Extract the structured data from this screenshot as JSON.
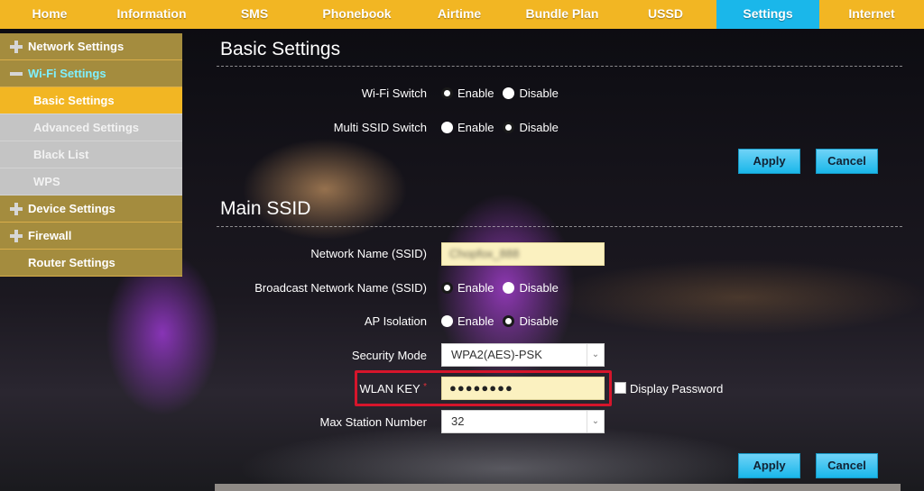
{
  "topnav": {
    "tabs": [
      {
        "label": "Home"
      },
      {
        "label": "Information"
      },
      {
        "label": "SMS"
      },
      {
        "label": "Phonebook"
      },
      {
        "label": "Airtime"
      },
      {
        "label": "Bundle Plan"
      },
      {
        "label": "USSD"
      },
      {
        "label": "Settings",
        "active": true
      },
      {
        "label": "Internet"
      }
    ]
  },
  "sidebar": {
    "items": [
      {
        "label": "Network Settings",
        "type": "group",
        "icon": "plus-icon"
      },
      {
        "label": "Wi-Fi Settings",
        "type": "group",
        "icon": "minus-icon",
        "expanded": true
      },
      {
        "label": "Basic Settings",
        "type": "sub",
        "active": true
      },
      {
        "label": "Advanced Settings",
        "type": "sub"
      },
      {
        "label": "Black List",
        "type": "sub"
      },
      {
        "label": "WPS",
        "type": "sub"
      },
      {
        "label": "Device Settings",
        "type": "group",
        "icon": "plus-icon"
      },
      {
        "label": "Firewall",
        "type": "group",
        "icon": "plus-icon"
      },
      {
        "label": "Router Settings",
        "type": "group"
      }
    ]
  },
  "basic": {
    "title": "Basic Settings",
    "wifi_switch": {
      "label": "Wi-Fi Switch",
      "options": [
        "Enable",
        "Disable"
      ],
      "selected": "Enable"
    },
    "multi_ssid": {
      "label": "Multi SSID Switch",
      "options": [
        "Enable",
        "Disable"
      ],
      "selected": "Disable"
    },
    "apply": "Apply",
    "cancel": "Cancel"
  },
  "main_ssid": {
    "title": "Main SSID",
    "network_name": {
      "label": "Network Name (SSID)",
      "value": "Chopfox_888"
    },
    "broadcast": {
      "label": "Broadcast Network Name (SSID)",
      "options": [
        "Enable",
        "Disable"
      ],
      "selected": "Enable"
    },
    "ap_isolation": {
      "label": "AP Isolation",
      "options": [
        "Enable",
        "Disable"
      ],
      "selected": "Disable"
    },
    "security_mode": {
      "label": "Security Mode",
      "value": "WPA2(AES)-PSK"
    },
    "wlan_key": {
      "label": "WLAN KEY",
      "required_mark": "*",
      "value": "●●●●●●●●"
    },
    "display_password": "Display Password",
    "max_station": {
      "label": "Max Station Number",
      "value": "32"
    },
    "apply": "Apply",
    "cancel": "Cancel"
  },
  "colors": {
    "nav_yellow": "#f2b623",
    "active_blue": "#1ab7ea",
    "sidebar_group": "#a48c3e",
    "sidebar_sub": "#c4c4c4",
    "highlight_red": "#d6152b"
  }
}
